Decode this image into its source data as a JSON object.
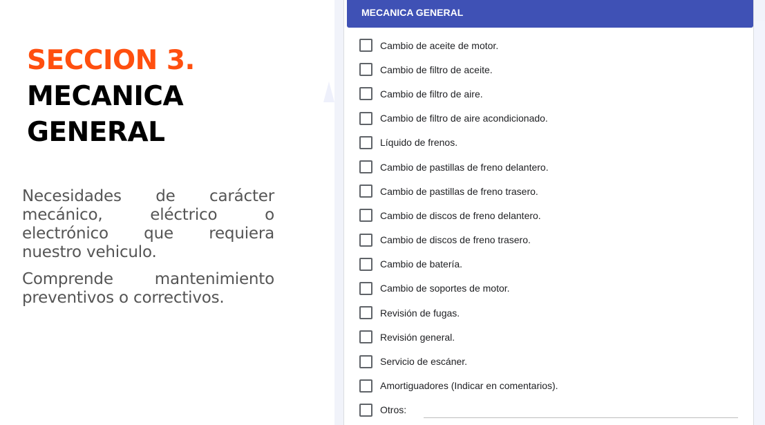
{
  "intro": {
    "section_label": "SECCION 3.",
    "title_line1": "MECANICA",
    "title_line2": "GENERAL",
    "paragraph1": "Necesidades de carácter mecánico, eléctrico o electrónico que requiera nuestro vehiculo.",
    "paragraph2": "Comprende mantenimiento preventivos o correctivos."
  },
  "form": {
    "header": "MECANICA GENERAL",
    "options": [
      {
        "label": "Cambio de aceite de motor.",
        "checked": false
      },
      {
        "label": "Cambio de filtro de aceite.",
        "checked": false
      },
      {
        "label": "Cambio de filtro de aire.",
        "checked": false
      },
      {
        "label": "Cambio de filtro de aire acondicionado.",
        "checked": false
      },
      {
        "label": "Líquido de frenos.",
        "checked": false
      },
      {
        "label": "Cambio de pastillas de freno delantero.",
        "checked": false
      },
      {
        "label": "Cambio de pastillas de freno trasero.",
        "checked": false
      },
      {
        "label": "Cambio de discos de freno delantero.",
        "checked": false
      },
      {
        "label": "Cambio de discos de freno trasero.",
        "checked": false
      },
      {
        "label": "Cambio de batería.",
        "checked": false
      },
      {
        "label": "Cambio de soportes de motor.",
        "checked": false
      },
      {
        "label": "Revisión de fugas.",
        "checked": false
      },
      {
        "label": "Revisión general.",
        "checked": false
      },
      {
        "label": "Servicio de escáner.",
        "checked": false
      },
      {
        "label": "Amortiguadores (Indicar en comentarios).",
        "checked": false
      }
    ],
    "other": {
      "label": "Otros:",
      "value": ""
    }
  },
  "colors": {
    "section_accent": "#ff4f0f",
    "header_bg": "#3f51b5",
    "body_text": "#555555"
  }
}
